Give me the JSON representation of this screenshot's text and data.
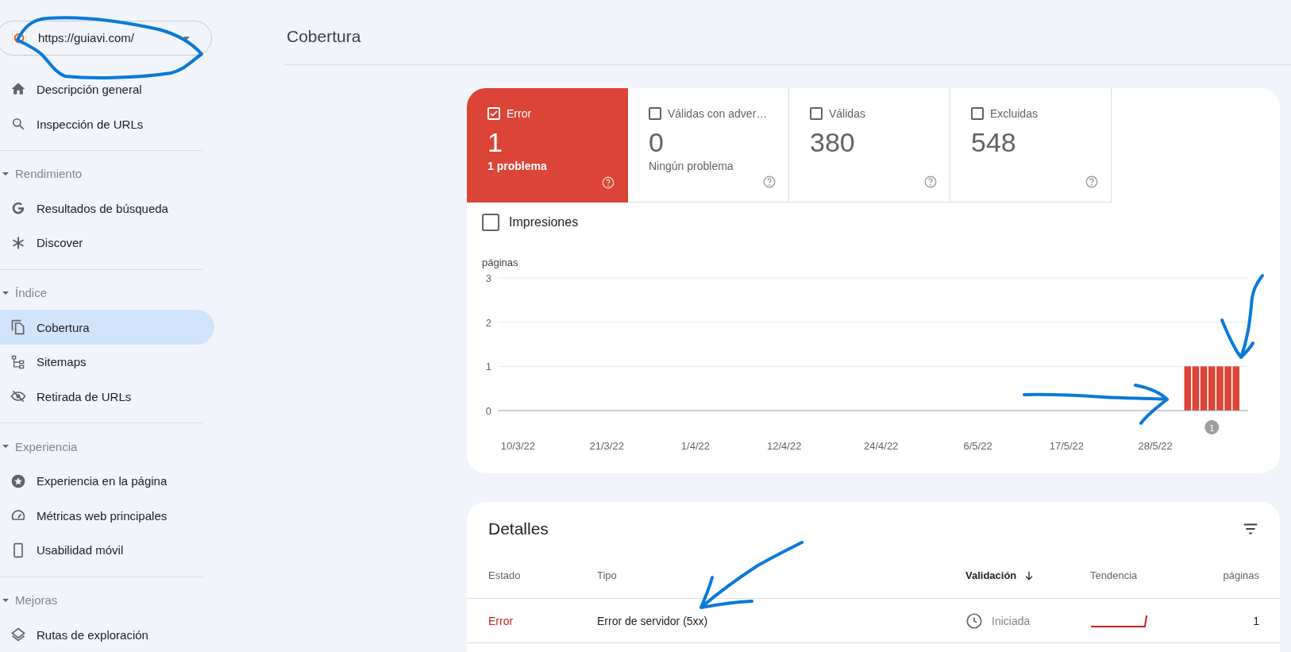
{
  "property_selector": {
    "url": "https://guiavi.com/"
  },
  "sidebar": {
    "items": [
      {
        "label": "Descripción general",
        "selected": false
      },
      {
        "label": "Inspección de URLs",
        "selected": false
      }
    ],
    "sections": [
      {
        "title": "Rendimiento",
        "expanded": true,
        "items": [
          {
            "label": "Resultados de búsqueda",
            "selected": false
          },
          {
            "label": "Discover",
            "selected": false
          }
        ]
      },
      {
        "title": "Índice",
        "expanded": true,
        "items": [
          {
            "label": "Cobertura",
            "selected": true
          },
          {
            "label": "Sitemaps",
            "selected": false
          },
          {
            "label": "Retirada de URLs",
            "selected": false
          }
        ]
      },
      {
        "title": "Experiencia",
        "expanded": true,
        "items": [
          {
            "label": "Experiencia en la página",
            "selected": false
          },
          {
            "label": "Métricas web principales",
            "selected": false
          },
          {
            "label": "Usabilidad móvil",
            "selected": false
          }
        ]
      },
      {
        "title": "Mejoras",
        "expanded": true,
        "items": [
          {
            "label": "Rutas de exploración",
            "selected": false
          }
        ]
      }
    ]
  },
  "page_title": "Cobertura",
  "summary": {
    "tiles": [
      {
        "label": "Error",
        "value": "1",
        "note": "1 problema",
        "checked": true
      },
      {
        "label": "Válidas con adver…",
        "value": "0",
        "note": "Ningún problema",
        "checked": false
      },
      {
        "label": "Válidas",
        "value": "380",
        "checked": false
      },
      {
        "label": "Excluidas",
        "value": "548",
        "checked": false
      }
    ],
    "impressions": {
      "label": "Impresiones",
      "checked": false
    },
    "chart_data": {
      "type": "bar",
      "ylabel": "páginas",
      "categories": [
        null,
        null,
        "10/3/22",
        null,
        null,
        null,
        null,
        null,
        null,
        null,
        null,
        null,
        null,
        "21/3/22",
        null,
        null,
        null,
        null,
        null,
        null,
        null,
        null,
        null,
        null,
        "1/4/22",
        null,
        null,
        null,
        null,
        null,
        null,
        null,
        null,
        null,
        null,
        "12/4/22",
        null,
        null,
        null,
        null,
        null,
        null,
        null,
        null,
        null,
        null,
        null,
        "24/4/22",
        null,
        null,
        null,
        null,
        null,
        null,
        null,
        null,
        null,
        null,
        null,
        "6/5/22",
        null,
        null,
        null,
        null,
        null,
        null,
        null,
        null,
        null,
        null,
        "17/5/22",
        null,
        null,
        null,
        null,
        null,
        null,
        null,
        null,
        null,
        null,
        "28/5/22",
        null,
        null,
        null,
        null,
        null,
        null,
        null,
        null,
        null,
        null,
        null
      ],
      "series": [
        {
          "color": "#db4437",
          "values": [
            0,
            0,
            0,
            0,
            0,
            0,
            0,
            0,
            0,
            0,
            0,
            0,
            0,
            0,
            0,
            0,
            0,
            0,
            0,
            0,
            0,
            0,
            0,
            0,
            0,
            0,
            0,
            0,
            0,
            0,
            0,
            0,
            0,
            0,
            0,
            0,
            0,
            0,
            0,
            0,
            0,
            0,
            0,
            0,
            0,
            0,
            0,
            0,
            0,
            0,
            0,
            0,
            0,
            0,
            0,
            0,
            0,
            0,
            0,
            0,
            0,
            0,
            0,
            0,
            0,
            0,
            0,
            0,
            0,
            0,
            0,
            0,
            0,
            0,
            0,
            0,
            0,
            0,
            0,
            0,
            0,
            0,
            0,
            0,
            0,
            1,
            1,
            1,
            1,
            1,
            1,
            1,
            0
          ]
        }
      ],
      "ylim": [
        0,
        3
      ],
      "yticks": [
        0,
        1,
        2,
        3
      ],
      "annotations": [
        "1"
      ]
    }
  },
  "details": {
    "title": "Detalles",
    "columns": [
      {
        "label": "Estado",
        "sorted": false
      },
      {
        "label": "Tipo",
        "sorted": false
      },
      {
        "label": "Validación",
        "sorted": true
      },
      {
        "label": "Tendencia",
        "sorted": false
      },
      {
        "label": "páginas",
        "sorted": false
      }
    ],
    "rows": [
      {
        "status": "Error",
        "type": "Error de servidor (5xx)",
        "validation": "Iniciada",
        "pages": "1"
      }
    ]
  }
}
